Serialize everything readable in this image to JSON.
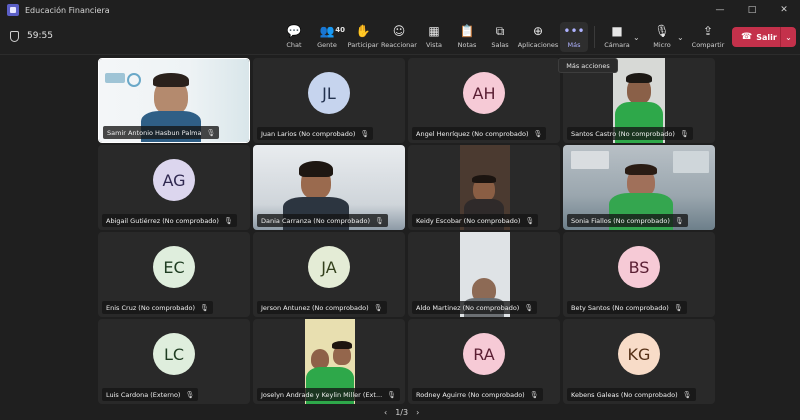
{
  "window": {
    "title": "Educación Financiera",
    "controls": [
      "—",
      "□",
      "✕"
    ]
  },
  "meeting": {
    "timer": "59:55"
  },
  "toolbar": {
    "items": [
      {
        "label": "Chat",
        "icon": "chat-icon",
        "glyph": "💬"
      },
      {
        "label": "Gente",
        "icon": "people-icon",
        "glyph": "👥",
        "count": "40"
      },
      {
        "label": "Participar",
        "icon": "hand-icon",
        "glyph": "✋"
      },
      {
        "label": "Reaccionar",
        "icon": "smile-icon",
        "glyph": "☺"
      },
      {
        "label": "Vista",
        "icon": "grid-icon",
        "glyph": "▦"
      },
      {
        "label": "Notas",
        "icon": "notes-icon",
        "glyph": "📋"
      },
      {
        "label": "Salas",
        "icon": "rooms-icon",
        "glyph": "⧉"
      },
      {
        "label": "Aplicaciones",
        "icon": "plus-icon",
        "glyph": "⊕"
      },
      {
        "label": "Más",
        "icon": "more-icon",
        "glyph": "•••"
      }
    ],
    "camera": {
      "label": "Cámara",
      "glyph": "■"
    },
    "mic": {
      "label": "Micro",
      "glyph": "🎙"
    },
    "share": {
      "label": "Compartir",
      "glyph": "⇪"
    },
    "leave": {
      "label": "Salir",
      "glyph": "☎"
    },
    "tooltip": "Más acciones"
  },
  "participants": [
    {
      "name": "Samir Antonio Hasbun Palma",
      "video": true
    },
    {
      "name": "Juan Larios (No comprobado)",
      "initials": "JL",
      "color": "#c6d4ee"
    },
    {
      "name": "Angel Henríquez (No comprobado)",
      "initials": "AH",
      "color": "#f6cad6"
    },
    {
      "name": "Santos Castro (No comprobado)",
      "video": true
    },
    {
      "name": "Abigail Gutiérrez (No comprobado)",
      "initials": "AG",
      "color": "#dcd6ee"
    },
    {
      "name": "Dania Carranza (No comprobado)",
      "video": true
    },
    {
      "name": "Keidy Escobar (No comprobado)",
      "video": true
    },
    {
      "name": "Sonia Fiallos (No comprobado)",
      "video": true
    },
    {
      "name": "Enis Cruz (No comprobado)",
      "initials": "EC",
      "color": "#dfeedd"
    },
    {
      "name": "Jerson Antunez (No comprobado)",
      "initials": "JA",
      "color": "#e4ecd6"
    },
    {
      "name": "Aldo Martinez (No comprobado)",
      "video": true
    },
    {
      "name": "Bety Santos (No comprobado)",
      "initials": "BS",
      "color": "#f6cad6"
    },
    {
      "name": "Luis Cardona (Externo)",
      "initials": "LC",
      "color": "#dfeedd"
    },
    {
      "name": "Joselyn Andrade y Keylin Miller (Ext...",
      "video": true
    },
    {
      "name": "Rodney Aguirre (No comprobado)",
      "initials": "RA",
      "color": "#f6cad6"
    },
    {
      "name": "Kebens Galeas (No comprobado)",
      "initials": "KG",
      "color": "#f8dcc8"
    }
  ],
  "pagination": {
    "label": "1/3",
    "prev": "‹",
    "next": "›"
  }
}
